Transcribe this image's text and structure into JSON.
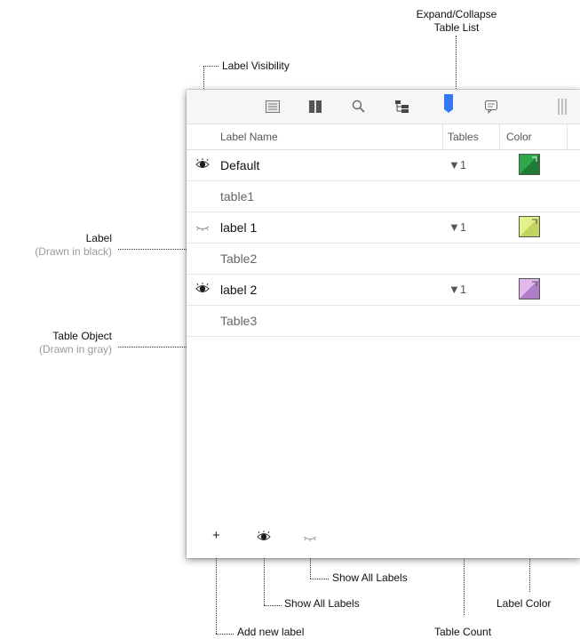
{
  "callouts": {
    "expand_collapse": "Expand/Collapse\nTable List",
    "label_visibility": "Label Visibility",
    "label_title": "Label",
    "label_sub": "(Drawn in black)",
    "table_object_title": "Table Object",
    "table_object_sub": "(Drawn in gray)",
    "show_all_labels_1": "Show All Labels",
    "show_all_labels_2": "Show All Labels",
    "add_new_label": "Add new label",
    "table_count": "Table Count",
    "label_color": "Label Color"
  },
  "columns": {
    "name": "Label Name",
    "tables": "Tables",
    "color": "Color"
  },
  "toolbar_icons": [
    "list-icon",
    "book-icon",
    "search-icon",
    "tree-icon",
    "bookmark-icon",
    "comment-icon",
    "divider-icon"
  ],
  "rows": [
    {
      "type": "label",
      "name": "Default",
      "visible": true,
      "count": "1",
      "color": "#2fa84a"
    },
    {
      "type": "table",
      "name": "table1"
    },
    {
      "type": "label",
      "name": "label 1",
      "visible": false,
      "count": "1",
      "color": "#d4e86a"
    },
    {
      "type": "table",
      "name": "Table2"
    },
    {
      "type": "label",
      "name": "label 2",
      "visible": true,
      "count": "1",
      "color": "#c98bd8"
    },
    {
      "type": "table",
      "name": "Table3"
    }
  ],
  "bottom_bar": {
    "add": "+",
    "icons": [
      "eye-icon",
      "eye-closed-icon"
    ]
  },
  "colors": {
    "accent_blue": "#3478f6",
    "text_gray": "#666666"
  }
}
